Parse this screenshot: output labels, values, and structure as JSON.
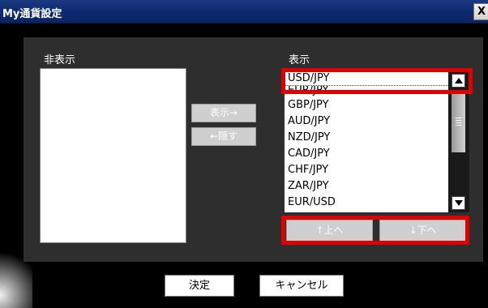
{
  "window": {
    "title": "My通貨設定",
    "close_label": "X"
  },
  "labels": {
    "hidden": "非表示",
    "shown": "表示"
  },
  "transfer_buttons": {
    "show": "表示→",
    "hide": "←隠す"
  },
  "shown_list": {
    "items": [
      "USD/JPY",
      "EUR/JPY",
      "GBP/JPY",
      "AUD/JPY",
      "NZD/JPY",
      "CAD/JPY",
      "CHF/JPY",
      "ZAR/JPY",
      "EUR/USD"
    ],
    "selected": "USD/JPY"
  },
  "order_buttons": {
    "up": "↑上へ",
    "down": "↓下へ"
  },
  "dialog_buttons": {
    "ok": "決定",
    "cancel": "キャンセル"
  },
  "colors": {
    "titlebar": "#0d2a6e",
    "highlight": "#e00000",
    "panel": "#2e2e2e"
  }
}
